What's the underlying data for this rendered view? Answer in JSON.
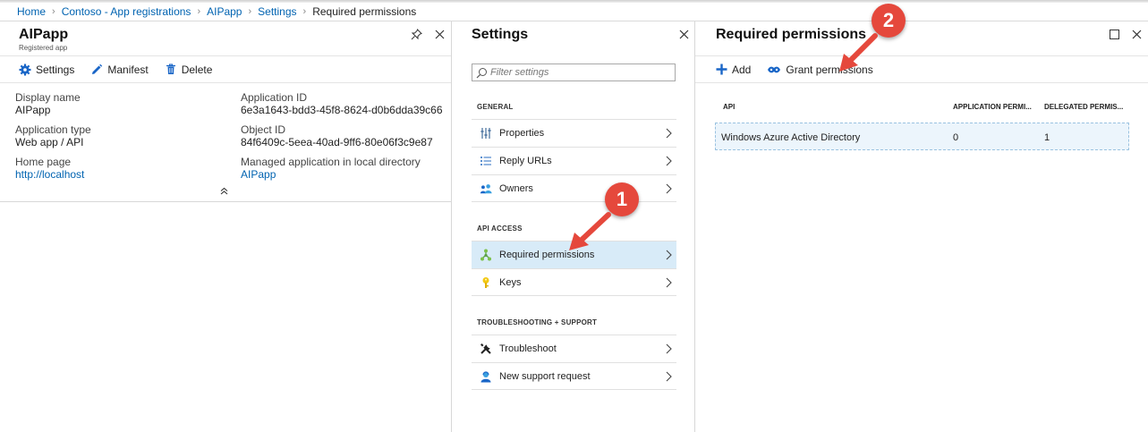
{
  "breadcrumb": [
    "Home",
    "Contoso - App registrations",
    "AIPapp",
    "Settings",
    "Required permissions"
  ],
  "app_blade": {
    "title": "AIPapp",
    "subtitle": "Registered app",
    "commands": {
      "settings": "Settings",
      "manifest": "Manifest",
      "delete": "Delete"
    },
    "fields": {
      "display_name": {
        "label": "Display name",
        "value": "AIPapp"
      },
      "application_id": {
        "label": "Application ID",
        "value": "6e3a1643-bdd3-45f8-8624-d0b6dda39c66"
      },
      "application_type": {
        "label": "Application type",
        "value": "Web app / API"
      },
      "object_id": {
        "label": "Object ID",
        "value": "84f6409c-5eea-40ad-9ff6-80e06f3c9e87"
      },
      "home_page": {
        "label": "Home page",
        "value": "http://localhost"
      },
      "managed_app": {
        "label": "Managed application in local directory",
        "value": "AIPapp"
      }
    }
  },
  "settings_blade": {
    "title": "Settings",
    "filter_placeholder": "Filter settings",
    "sections": {
      "general": {
        "header": "GENERAL",
        "items": [
          "Properties",
          "Reply URLs",
          "Owners"
        ]
      },
      "api_access": {
        "header": "API ACCESS",
        "items": [
          "Required permissions",
          "Keys"
        ]
      },
      "troubleshooting": {
        "header": "TROUBLESHOOTING + SUPPORT",
        "items": [
          "Troubleshoot",
          "New support request"
        ]
      }
    },
    "selected_item": "Required permissions"
  },
  "permissions_blade": {
    "title": "Required permissions",
    "commands": {
      "add": "Add",
      "grant": "Grant permissions"
    },
    "columns": [
      "API",
      "APPLICATION PERMI...",
      "DELEGATED PERMIS..."
    ],
    "rows": [
      {
        "api": "Windows Azure Active Directory",
        "application": "0",
        "delegated": "1"
      }
    ]
  },
  "callouts": [
    "1",
    "2"
  ],
  "colors": {
    "accent": "#0078d4",
    "link": "#0063b1",
    "selected": "#d8ebf8",
    "callout": "#e5483c"
  }
}
